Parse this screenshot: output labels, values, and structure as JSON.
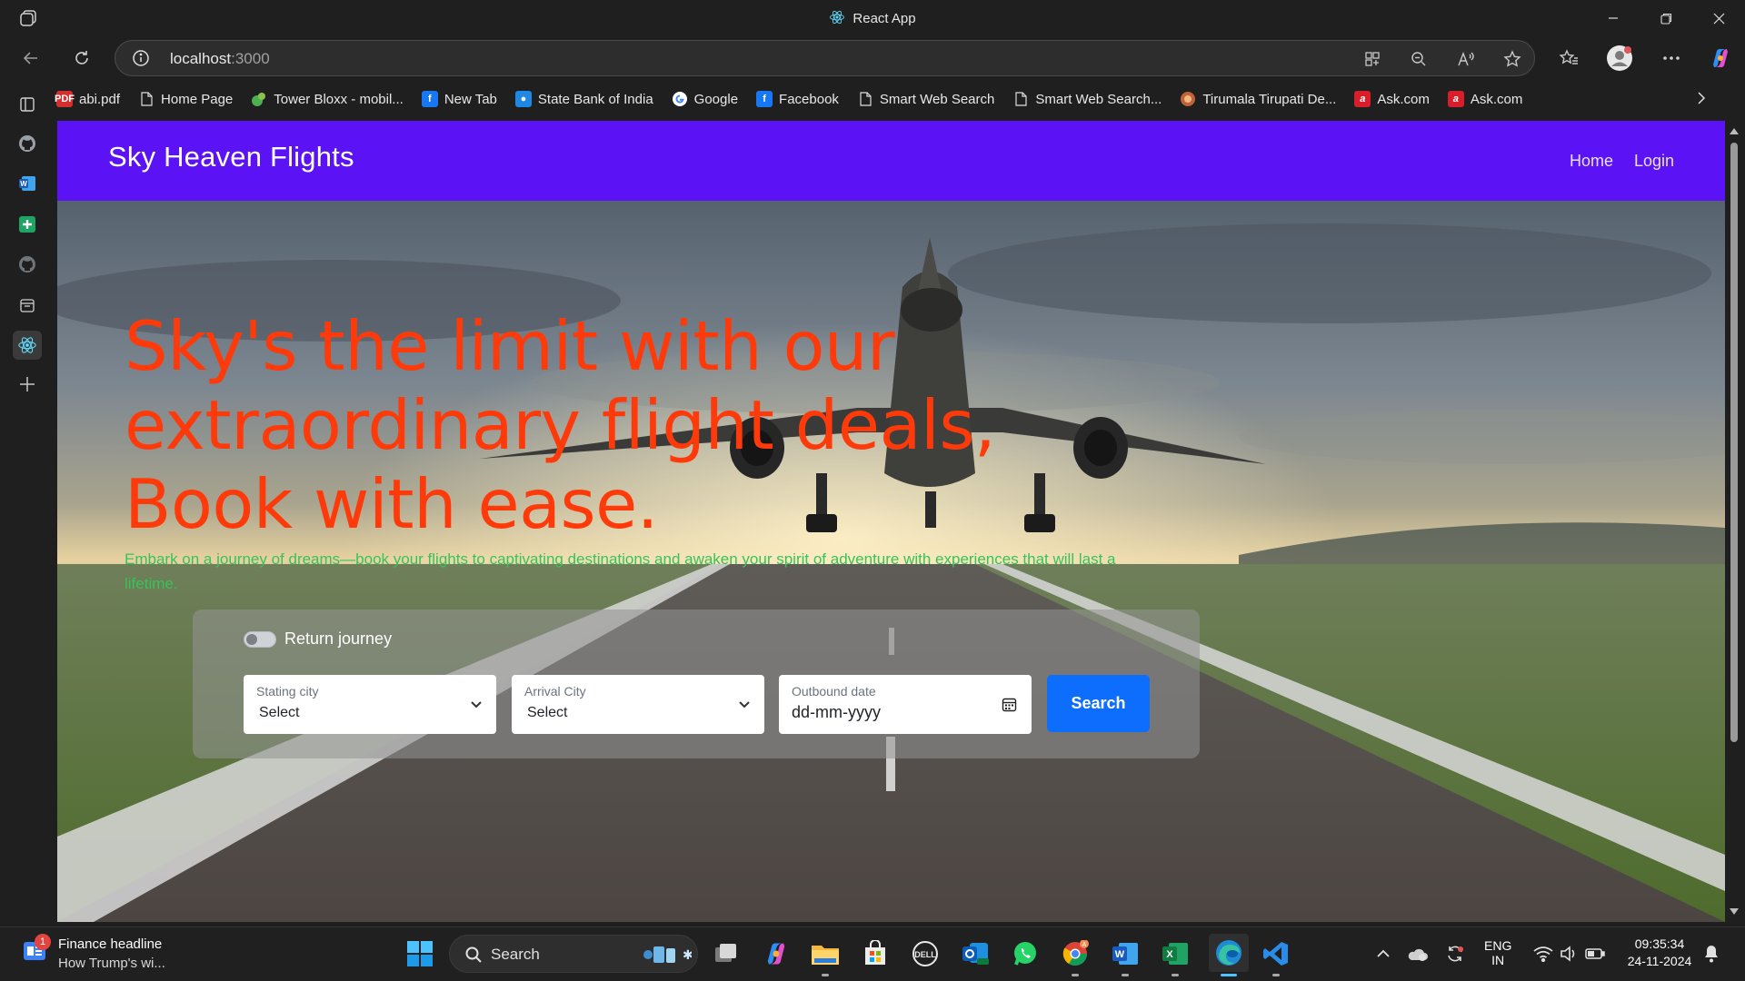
{
  "window": {
    "title": "React App"
  },
  "address_bar": {
    "host": "localhost",
    "port": ":3000"
  },
  "bookmarks": [
    {
      "label": "abi.pdf",
      "icon": "pdf-icon",
      "color": "#d32f2f"
    },
    {
      "label": "Home Page",
      "icon": "page-icon",
      "color": ""
    },
    {
      "label": "Tower Bloxx - mobil...",
      "icon": "tower-bloxx-icon",
      "color": "#4caf50"
    },
    {
      "label": "New Tab",
      "icon": "facebook-icon",
      "color": "#1877f2"
    },
    {
      "label": "State Bank of India",
      "icon": "sbi-icon",
      "color": "#1e88e5"
    },
    {
      "label": "Google",
      "icon": "google-icon",
      "color": "#ffffff"
    },
    {
      "label": "Facebook",
      "icon": "facebook-icon",
      "color": "#1877f2"
    },
    {
      "label": "Smart Web Search",
      "icon": "page-icon",
      "color": ""
    },
    {
      "label": "Smart Web Search...",
      "icon": "page-icon",
      "color": ""
    },
    {
      "label": "Tirumala Tirupati De...",
      "icon": "ttd-icon",
      "color": "#c0623a"
    },
    {
      "label": "Ask.com",
      "icon": "ask-icon",
      "color": "#d71e2a"
    },
    {
      "label": "Ask.com",
      "icon": "ask-icon",
      "color": "#d71e2a"
    }
  ],
  "app": {
    "brand": "Sky Heaven Flights",
    "nav": {
      "home": "Home",
      "login": "Login"
    },
    "hero_title": "Sky's the limit with our extraordinary flight deals, Book with ease.",
    "hero_subtitle": "Embark on a journey of dreams—book your flights to captivating destinations and awaken your spirit of adventure with experiences that will last a lifetime.",
    "return_journey_label": "Return journey",
    "return_journey_on": false,
    "starting_city": {
      "label": "Stating city",
      "value": "Select"
    },
    "arrival_city": {
      "label": "Arrival City",
      "value": "Select"
    },
    "outbound_date": {
      "label": "Outbound date",
      "value": "dd-mm-yyyy"
    },
    "search_label": "Search",
    "colors": {
      "nav_bg": "#5b12f4",
      "title": "#ff3a0a",
      "subtitle": "#38c25a",
      "search_btn": "#0d6efd"
    }
  },
  "taskbar": {
    "news_title": "Finance headline",
    "news_sub": "How Trump's wi...",
    "news_badge": "1",
    "search_label": "Search",
    "lang_top": "ENG",
    "lang_bottom": "IN",
    "time": "09:35:34",
    "date": "24-11-2024",
    "chrome_badge": "A"
  }
}
